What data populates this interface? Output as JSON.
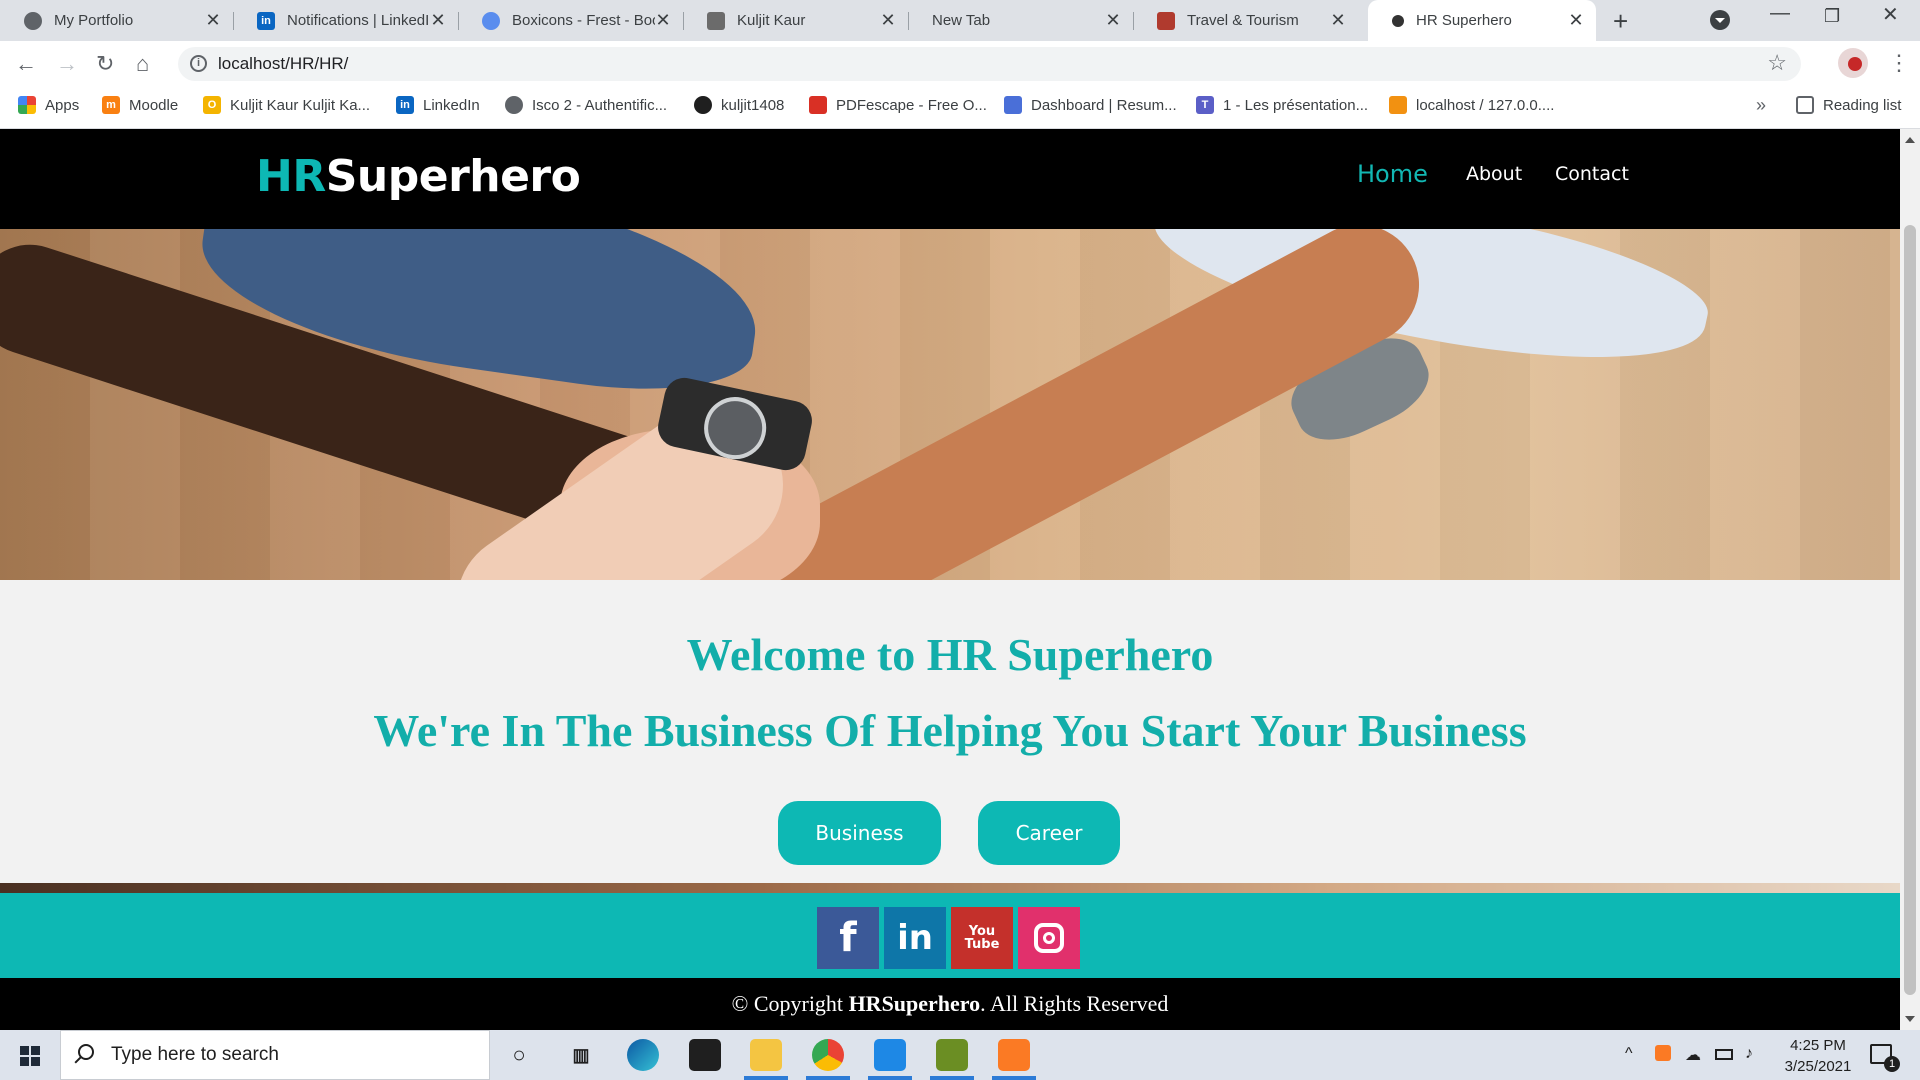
{
  "browser": {
    "tabs": [
      {
        "title": "My Portfolio",
        "icon": "globe-icon",
        "color": "#5f6368"
      },
      {
        "title": "Notifications | LinkedIn",
        "icon": "linkedin-icon",
        "color": "#0a66c2"
      },
      {
        "title": "Boxicons - Frest - Boo",
        "icon": "boxicons-icon",
        "color": "#5a8dee"
      },
      {
        "title": "Kuljit Kaur",
        "icon": "map-icon",
        "color": "#6b6b6b"
      },
      {
        "title": "New Tab",
        "icon": "",
        "color": ""
      },
      {
        "title": "Travel & Tourism",
        "icon": "travel-icon",
        "color": "#b03a2e"
      },
      {
        "title": "HR Superhero",
        "icon": "hr-superhero-icon",
        "color": "#333333"
      }
    ],
    "active_tab_index": 6,
    "url": "localhost/HR/HR/",
    "bookmarks": [
      {
        "label": "Apps",
        "icon": "apps-grid-icon",
        "color": "#ea4335"
      },
      {
        "label": "Moodle",
        "icon": "moodle-icon",
        "color": "#f98012"
      },
      {
        "label": "Kuljit Kaur Kuljit Ka...",
        "icon": "kuljit-icon",
        "color": "#f4b400"
      },
      {
        "label": "LinkedIn",
        "icon": "linkedin-icon",
        "color": "#0a66c2"
      },
      {
        "label": "Isco 2 - Authentific...",
        "icon": "globe-icon",
        "color": "#5f6368"
      },
      {
        "label": "kuljit1408",
        "icon": "github-icon",
        "color": "#1f1f1f"
      },
      {
        "label": "PDFescape - Free O...",
        "icon": "pdfescape-icon",
        "color": "#d93025"
      },
      {
        "label": "Dashboard | Resum...",
        "icon": "document-icon",
        "color": "#4a6fd8"
      },
      {
        "label": "1 - Les présentation...",
        "icon": "teams-icon",
        "color": "#5b5fc7"
      },
      {
        "label": "localhost / 127.0.0....",
        "icon": "phpmyadmin-icon",
        "color": "#f29111"
      }
    ],
    "reading_list": "Reading list"
  },
  "site": {
    "logo": {
      "part1": "HR",
      "part2": "Superhero"
    },
    "nav": [
      "Home",
      "About",
      "Contact"
    ],
    "active_nav": "Home",
    "welcome_title": "Welcome to HR Superhero",
    "welcome_subtitle": "We're In The Business Of Helping You Start Your Business",
    "buttons": [
      "Business",
      "Career"
    ],
    "social": [
      {
        "name": "facebook",
        "glyph": "f",
        "color": "#3b5998"
      },
      {
        "name": "linkedin",
        "glyph": "in",
        "color": "#0e76a8"
      },
      {
        "name": "youtube",
        "glyph": "You Tube",
        "color": "#c4302b"
      },
      {
        "name": "instagram",
        "glyph": "",
        "color": "#e1306c"
      }
    ],
    "copyright": {
      "prefix": "© Copyright ",
      "brand": "HRSuperhero",
      "suffix": ". All Rights Reserved"
    },
    "accent": "#0db8b4"
  },
  "taskbar": {
    "search_placeholder": "Type here to search",
    "time": "4:25 PM",
    "date": "3/25/2021",
    "notification_count": "1"
  }
}
